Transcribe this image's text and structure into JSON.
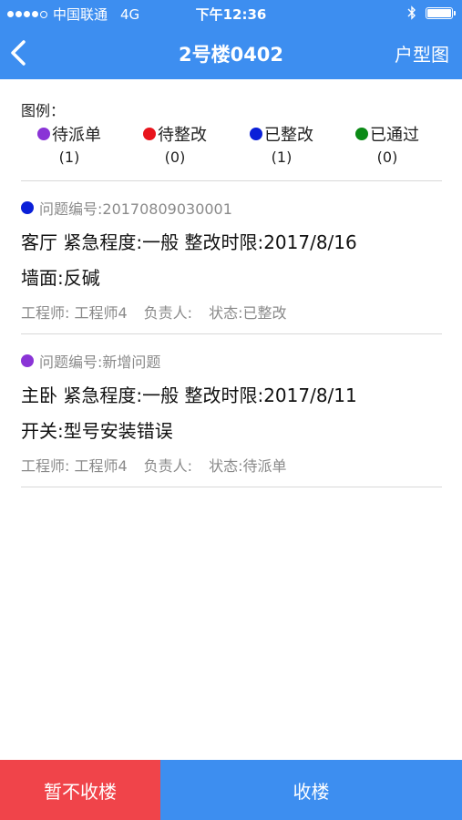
{
  "status_bar": {
    "carrier": "中国联通",
    "network": "4G",
    "time": "下午12:36"
  },
  "nav": {
    "title": "2号楼0402",
    "right_action": "户型图"
  },
  "legend": {
    "label": "图例：",
    "items": [
      {
        "label": "待派单",
        "count": "(1)",
        "color": "#8a34d6"
      },
      {
        "label": "待整改",
        "count": "(0)",
        "color": "#e8141c"
      },
      {
        "label": "已整改",
        "count": "(1)",
        "color": "#0a1fd8"
      },
      {
        "label": "已通过",
        "count": "(0)",
        "color": "#0b8a16"
      }
    ]
  },
  "issues": [
    {
      "color": "#0a1fd8",
      "id_text": "问题编号:20170809030001",
      "line1": "客厅  紧急程度:一般  整改时限:2017/8/16",
      "line2": "墙面:反碱",
      "engineer": "工程师: 工程师4",
      "owner": "负责人:",
      "status": "状态:已整改"
    },
    {
      "color": "#8a34d6",
      "id_text": "问题编号:新增问题",
      "line1": "主卧  紧急程度:一般  整改时限:2017/8/11",
      "line2": "开关:型号安装错误",
      "engineer": "工程师: 工程师4",
      "owner": "负责人:",
      "status": "状态:待派单"
    }
  ],
  "buttons": {
    "left": "暂不收楼",
    "right": "收楼"
  }
}
